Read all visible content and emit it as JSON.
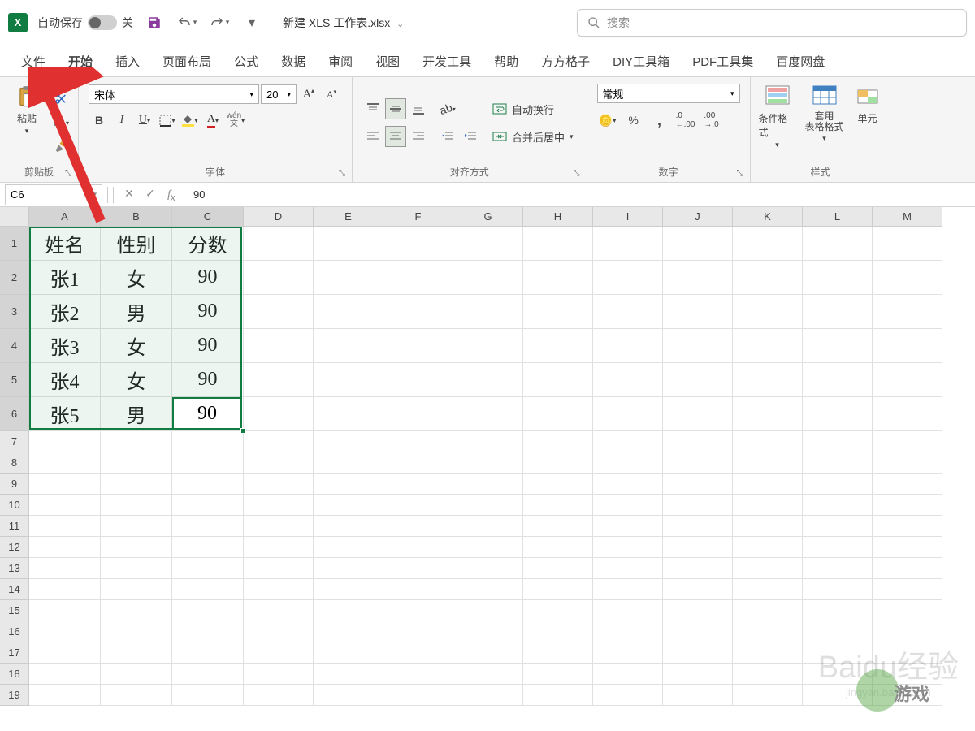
{
  "titlebar": {
    "autosave_label": "自动保存",
    "autosave_state": "关",
    "filename": "新建 XLS 工作表.xlsx"
  },
  "search": {
    "placeholder": "搜索"
  },
  "tabs": [
    "文件",
    "开始",
    "插入",
    "页面布局",
    "公式",
    "数据",
    "审阅",
    "视图",
    "开发工具",
    "帮助",
    "方方格子",
    "DIY工具箱",
    "PDF工具集",
    "百度网盘"
  ],
  "active_tab": 1,
  "ribbon": {
    "clipboard": {
      "paste": "粘贴",
      "label": "剪贴板"
    },
    "font": {
      "name": "宋体",
      "size": "20",
      "label": "字体",
      "pinyin": "wén"
    },
    "alignment": {
      "wrap": "自动换行",
      "merge": "合并后居中",
      "label": "对齐方式"
    },
    "number": {
      "format": "常规",
      "label": "数字"
    },
    "styles": {
      "cond": "条件格式",
      "table": "套用\n表格格式",
      "cell": "单元",
      "label": "样式"
    }
  },
  "formula_bar": {
    "name_box": "C6",
    "value": "90"
  },
  "columns": [
    "A",
    "B",
    "C",
    "D",
    "E",
    "F",
    "G",
    "H",
    "I",
    "J",
    "K",
    "L",
    "M"
  ],
  "col_widths": {
    "data": 88,
    "empty": 86
  },
  "row_heights": {
    "data": 42,
    "empty": 26
  },
  "data_rows": 6,
  "empty_rows": 13,
  "table": {
    "headers": [
      "姓名",
      "性别",
      "分数"
    ],
    "rows": [
      [
        "张1",
        "女",
        "90"
      ],
      [
        "张2",
        "男",
        "90"
      ],
      [
        "张3",
        "女",
        "90"
      ],
      [
        "张4",
        "女",
        "90"
      ],
      [
        "张5",
        "男",
        "90"
      ]
    ]
  },
  "selection": {
    "from": "A1",
    "to": "C6"
  },
  "active_cell": "C6",
  "watermark_text": "Baidu经验",
  "watermark_sub": "jingyan.baidu.com"
}
